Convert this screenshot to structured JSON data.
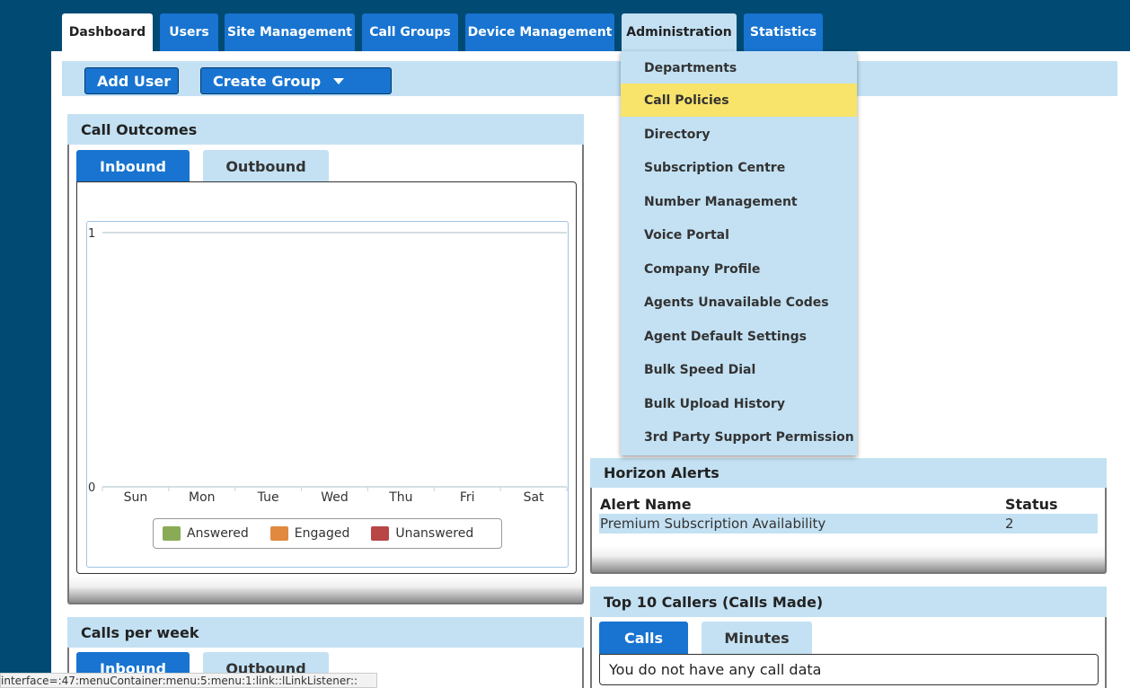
{
  "nav": {
    "tabs": [
      {
        "label": "Dashboard"
      },
      {
        "label": "Users"
      },
      {
        "label": "Site Management"
      },
      {
        "label": "Call Groups"
      },
      {
        "label": "Device Management"
      },
      {
        "label": "Administration"
      },
      {
        "label": "Statistics"
      }
    ]
  },
  "toolbar": {
    "add_user": "Add User",
    "create_group": "Create Group"
  },
  "administration_menu": {
    "items": [
      "Departments",
      "Call Policies",
      "Directory",
      "Subscription Centre",
      "Number Management",
      "Voice Portal",
      "Company Profile",
      "Agents Unavailable Codes",
      "Agent Default Settings",
      "Bulk Speed Dial",
      "Bulk Upload History",
      "3rd Party Support Permission"
    ],
    "highlighted": "Call Policies",
    "highlight_color": "#f9e46b"
  },
  "call_outcomes": {
    "title": "Call Outcomes",
    "tabs": {
      "inbound": "Inbound",
      "outbound": "Outbound"
    }
  },
  "chart_data": {
    "type": "bar",
    "categories": [
      "Sun",
      "Mon",
      "Tue",
      "Wed",
      "Thu",
      "Fri",
      "Sat"
    ],
    "series": [
      {
        "name": "Answered",
        "color": "#8aab56",
        "values": [
          0,
          0,
          0,
          0,
          0,
          0,
          0
        ]
      },
      {
        "name": "Engaged",
        "color": "#e0893f",
        "values": [
          0,
          0,
          0,
          0,
          0,
          0,
          0
        ]
      },
      {
        "name": "Unanswered",
        "color": "#b84646",
        "values": [
          0,
          0,
          0,
          0,
          0,
          0,
          0
        ]
      }
    ],
    "y_ticks": [
      "0",
      "1"
    ],
    "ylim": [
      0,
      1
    ],
    "legend": "bottom"
  },
  "calls_per_week": {
    "title": "Calls per week",
    "tabs": {
      "inbound": "Inbound",
      "outbound": "Outbound"
    }
  },
  "horizon_alerts": {
    "title": "Horizon Alerts",
    "columns": [
      "Alert Name",
      "Status"
    ],
    "rows": [
      {
        "name": "Premium Subscription Availability",
        "status": "2"
      }
    ]
  },
  "top_callers": {
    "title": "Top 10 Callers (Calls Made)",
    "tabs": {
      "calls": "Calls",
      "minutes": "Minutes"
    },
    "empty_message": "You do not have any call data"
  },
  "status_bar": {
    "text": "interface=:47:menuContainer:menu:5:menu:1:link::lLinkListener::"
  }
}
